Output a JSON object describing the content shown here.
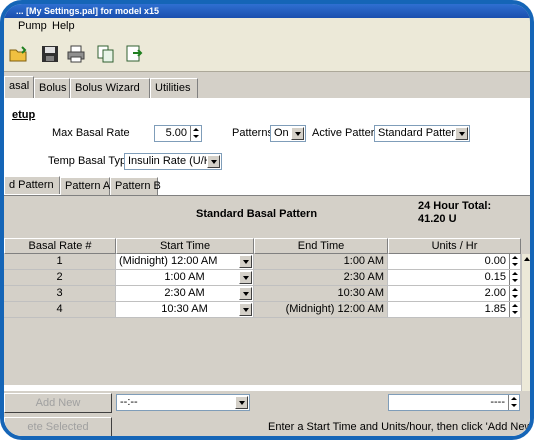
{
  "window": {
    "title": "... [My Settings.pal] for model x15"
  },
  "menu": {
    "items": [
      "Pump",
      "Help"
    ]
  },
  "tabs": [
    "asal",
    "Bolus",
    "Bolus Wizard",
    "Utilities"
  ],
  "setup": {
    "title": "etup",
    "max_basal_label": "Max Basal Rate",
    "max_basal_value": "5.00",
    "patterns_label": "Patterns",
    "patterns_value": "On",
    "active_pattern_label": "Active Pattern",
    "active_pattern_value": "Standard Pattern",
    "temp_basal_label": "Temp Basal Type",
    "temp_basal_value": "Insulin Rate (U/H)"
  },
  "pattern_tabs": [
    "d Pattern",
    "Pattern A",
    "Pattern B"
  ],
  "pattern": {
    "title": "Standard Basal Pattern",
    "total_label": "24 Hour Total:",
    "total_value": "41.20 U"
  },
  "columns": [
    "Basal Rate #",
    "Start Time",
    "End Time",
    "Units / Hr"
  ],
  "rows": [
    {
      "num": "1",
      "start": "(Midnight) 12:00 AM",
      "end": "1:00 AM",
      "units": "0.00"
    },
    {
      "num": "2",
      "start": "1:00 AM",
      "end": "2:30 AM",
      "units": "0.15"
    },
    {
      "num": "3",
      "start": "2:30 AM",
      "end": "10:30 AM",
      "units": "2.00"
    },
    {
      "num": "4",
      "start": "10:30 AM",
      "end": "(Midnight) 12:00 AM",
      "units": "1.85"
    }
  ],
  "footer": {
    "add_new": "Add New",
    "delete_selected": "ete Selected",
    "time_placeholder": "--:--",
    "units_placeholder": "----",
    "hint": "Enter a Start Time and Units/hour, then click 'Add New"
  }
}
